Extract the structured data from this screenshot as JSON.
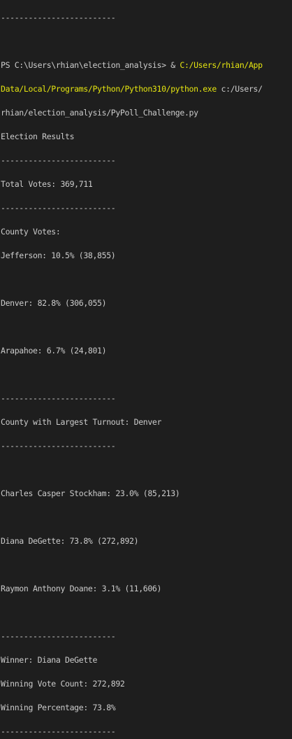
{
  "colors": {
    "background": "#1e1e1e",
    "text": "#cccccc",
    "path_highlight": "#e5e510"
  },
  "terminal": {
    "top_separator": "-------------------------",
    "prompt": "PS C:\\Users\\rhian\\election_analysis> & ",
    "exe_path_part1": "C:/Users/rhian/App",
    "exe_path_part2": "Data/Local/Programs/Python/Python310/python.exe",
    "script_arg_part1": " c:/Users/",
    "script_arg_part2": "rhian/election_analysis/PyPoll_Challenge.py",
    "lines": {
      "election_results": "Election Results",
      "sep1": "-------------------------",
      "total_votes": "Total Votes: 369,711",
      "sep2": "-------------------------",
      "county_votes": "County Votes:",
      "jefferson": "Jefferson: 10.5% (38,855)",
      "denver": "Denver: 82.8% (306,055)",
      "arapahoe": "Arapahoe: 6.7% (24,801)",
      "sep3": "-------------------------",
      "largest_turnout": "County with Largest Turnout: Denver",
      "sep4": "-------------------------",
      "stockham": "Charles Casper Stockham: 23.0% (85,213)",
      "degette": "Diana DeGette: 73.8% (272,892)",
      "doane": "Raymon Anthony Doane: 3.1% (11,606)",
      "sep5": "-------------------------",
      "winner": "Winner: Diana DeGette",
      "winning_count": "Winning Vote Count: 272,892",
      "winning_percentage": "Winning Percentage: 73.8%",
      "sep6": "-------------------------"
    }
  }
}
